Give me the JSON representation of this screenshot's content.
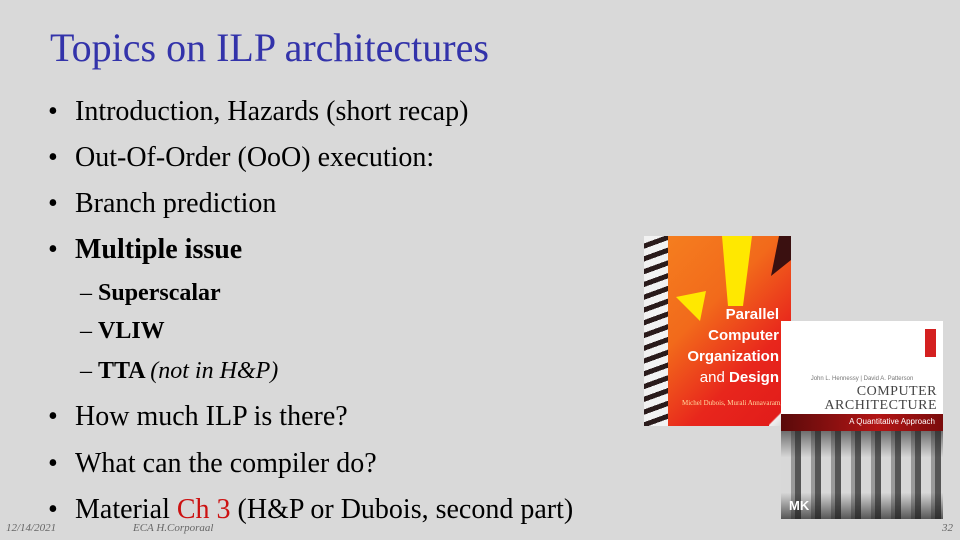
{
  "slide": {
    "title": "Topics on ILP architectures",
    "bullets": [
      {
        "text": "Introduction, Hazards (short recap)",
        "bold": false
      },
      {
        "text": "Out-Of-Order (OoO) execution:",
        "bold": false
      },
      {
        "text": "Branch prediction",
        "bold": false
      },
      {
        "text": "Multiple issue",
        "bold": true
      }
    ],
    "sub_bullets": [
      {
        "text": "Superscalar"
      },
      {
        "text": "VLIW"
      },
      {
        "text": "TTA",
        "note": "(not in H&P)"
      }
    ],
    "bullets2": [
      {
        "text": "How much ILP is there?"
      },
      {
        "text": "What can the compiler do?"
      },
      {
        "prefix": "Material ",
        "highlight": "Ch 3",
        "suffix": " (H&P or Dubois, second part)"
      }
    ],
    "bullet_glyph": "•",
    "dash_glyph": "–",
    "highlight_color": "#cc1111",
    "title_color": "#3333aa"
  },
  "footer": {
    "date": "12/14/2021",
    "author": "ECA  H.Corporaal",
    "page": "32"
  },
  "books": {
    "dubois": {
      "title_lines": [
        "Parallel",
        "Computer",
        "Organization"
      ],
      "title_last_light": "and ",
      "title_last_bold": "Design",
      "authors": "Michel Dubois, Murali Annavaram, Per Stenström"
    },
    "hp": {
      "authors": "John L. Hennessy | David A. Patterson",
      "title_line1": "COMPUTER",
      "title_line2": "ARCHITECTURE",
      "subtitle": "A Quantitative Approach",
      "publisher": "MK"
    }
  }
}
